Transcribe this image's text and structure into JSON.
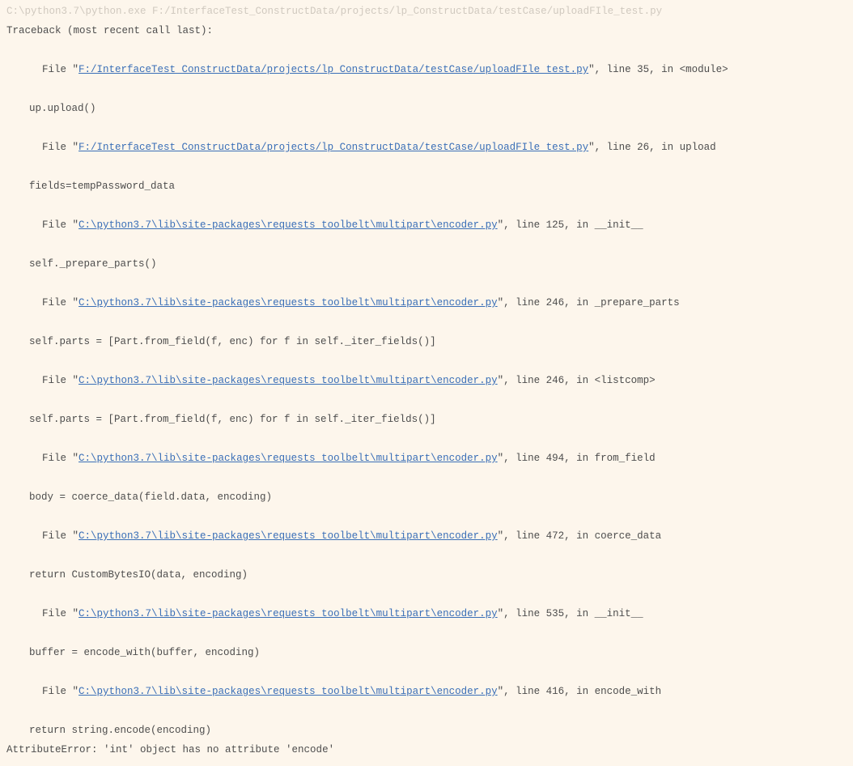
{
  "header": {
    "command": "C:\\python3.7\\python.exe F:/InterfaceTest_ConstructData/projects/lp_ConstructData/testCase/uploadFIle_test.py"
  },
  "traceback_intro": "Traceback (most recent call last):",
  "frames": [
    {
      "file_prefix": "File \"",
      "path": "F:/InterfaceTest ConstructData/projects/lp ConstructData/testCase/uploadFIle test.py",
      "suffix": "\", line 35, in <module>",
      "code": "up.upload()"
    },
    {
      "file_prefix": "File \"",
      "path": "F:/InterfaceTest ConstructData/projects/lp ConstructData/testCase/uploadFIle test.py",
      "suffix": "\", line 26, in upload",
      "code": "fields=tempPassword_data"
    },
    {
      "file_prefix": "File \"",
      "path": "C:\\python3.7\\lib\\site-packages\\requests toolbelt\\multipart\\encoder.py",
      "suffix": "\", line 125, in __init__",
      "code": "self._prepare_parts()"
    },
    {
      "file_prefix": "File \"",
      "path": "C:\\python3.7\\lib\\site-packages\\requests toolbelt\\multipart\\encoder.py",
      "suffix": "\", line 246, in _prepare_parts",
      "code": "self.parts = [Part.from_field(f, enc) for f in self._iter_fields()]"
    },
    {
      "file_prefix": "File \"",
      "path": "C:\\python3.7\\lib\\site-packages\\requests toolbelt\\multipart\\encoder.py",
      "suffix": "\", line 246, in <listcomp>",
      "code": "self.parts = [Part.from_field(f, enc) for f in self._iter_fields()]"
    },
    {
      "file_prefix": "File \"",
      "path": "C:\\python3.7\\lib\\site-packages\\requests toolbelt\\multipart\\encoder.py",
      "suffix": "\", line 494, in from_field",
      "code": "body = coerce_data(field.data, encoding)"
    },
    {
      "file_prefix": "File \"",
      "path": "C:\\python3.7\\lib\\site-packages\\requests toolbelt\\multipart\\encoder.py",
      "suffix": "\", line 472, in coerce_data",
      "code": "return CustomBytesIO(data, encoding)"
    },
    {
      "file_prefix": "File \"",
      "path": "C:\\python3.7\\lib\\site-packages\\requests toolbelt\\multipart\\encoder.py",
      "suffix": "\", line 535, in __init__",
      "code": "buffer = encode_with(buffer, encoding)"
    },
    {
      "file_prefix": "File \"",
      "path": "C:\\python3.7\\lib\\site-packages\\requests toolbelt\\multipart\\encoder.py",
      "suffix": "\", line 416, in encode_with",
      "code": "return string.encode(encoding)"
    }
  ],
  "error": "AttributeError: 'int' object has no attribute 'encode'"
}
